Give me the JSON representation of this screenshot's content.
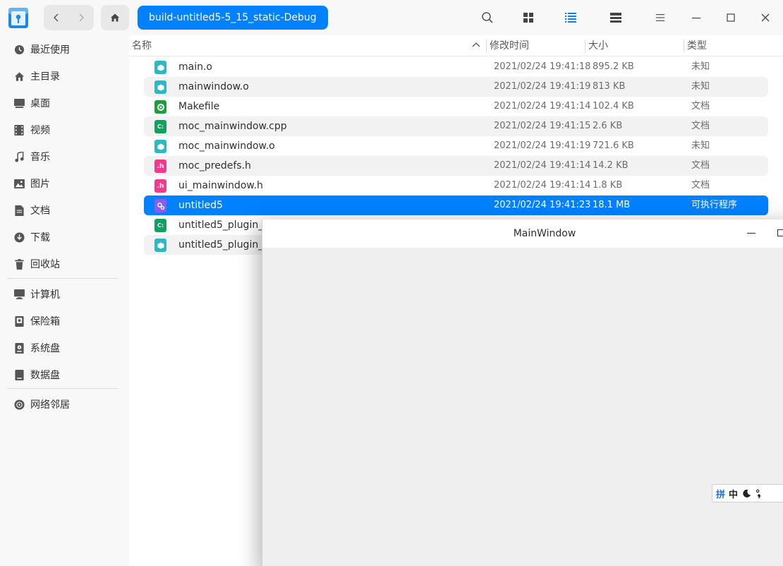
{
  "toolbar": {
    "breadcrumb": "build-untitled5-5_15_static-Debug",
    "icons": [
      "search-icon",
      "icon-view-icon",
      "list-view-icon",
      "detail-view-icon",
      "menu-icon",
      "minimize-icon",
      "maximize-icon",
      "close-icon"
    ]
  },
  "sidebar": {
    "items": [
      {
        "label": "最近使用",
        "icon": "recent-icon"
      },
      {
        "label": "主目录",
        "icon": "home-icon"
      },
      {
        "label": "桌面",
        "icon": "desktop-icon"
      },
      {
        "label": "视频",
        "icon": "video-icon"
      },
      {
        "label": "音乐",
        "icon": "music-icon"
      },
      {
        "label": "图片",
        "icon": "picture-icon"
      },
      {
        "label": "文档",
        "icon": "document-icon"
      },
      {
        "label": "下载",
        "icon": "download-icon"
      },
      {
        "label": "回收站",
        "icon": "trash-icon"
      },
      {
        "label": "计算机",
        "icon": "computer-icon"
      },
      {
        "label": "保险箱",
        "icon": "vault-icon"
      },
      {
        "label": "系统盘",
        "icon": "system-disk-icon"
      },
      {
        "label": "数据盘",
        "icon": "data-disk-icon"
      },
      {
        "label": "网络邻居",
        "icon": "network-icon"
      }
    ]
  },
  "columns": {
    "name": "名称",
    "modified": "修改时间",
    "size": "大小",
    "type": "类型"
  },
  "files": [
    {
      "name": "main.o",
      "modified": "2021/02/24 19:41:18",
      "size": "895.2 KB",
      "type": "未知",
      "icon": "object-file-icon"
    },
    {
      "name": "mainwindow.o",
      "modified": "2021/02/24 19:41:19",
      "size": "813 KB",
      "type": "未知",
      "icon": "object-file-icon"
    },
    {
      "name": "Makefile",
      "modified": "2021/02/24 19:41:14",
      "size": "102.4 KB",
      "type": "文档",
      "icon": "makefile-icon"
    },
    {
      "name": "moc_mainwindow.cpp",
      "modified": "2021/02/24 19:41:15",
      "size": "2.6 KB",
      "type": "文档",
      "icon": "cpp-file-icon"
    },
    {
      "name": "moc_mainwindow.o",
      "modified": "2021/02/24 19:41:19",
      "size": "721.6 KB",
      "type": "未知",
      "icon": "object-file-icon"
    },
    {
      "name": "moc_predefs.h",
      "modified": "2021/02/24 19:41:14",
      "size": "14.2 KB",
      "type": "文档",
      "icon": "header-file-icon"
    },
    {
      "name": "ui_mainwindow.h",
      "modified": "2021/02/24 19:41:14",
      "size": "1.8 KB",
      "type": "文档",
      "icon": "header-file-icon"
    },
    {
      "name": "untitled5",
      "modified": "2021/02/24 19:41:23",
      "size": "18.1 MB",
      "type": "可执行程序",
      "icon": "executable-icon"
    },
    {
      "name": "untitled5_plugin_",
      "modified": "",
      "size": "",
      "type": "",
      "icon": "cpp-file-icon"
    },
    {
      "name": "untitled5_plugin_",
      "modified": "",
      "size": "",
      "type": "",
      "icon": "object-file-icon"
    }
  ],
  "overlay_window": {
    "title": "MainWindow"
  },
  "ime": {
    "mode1": "拼",
    "mode2": "中"
  },
  "colors": {
    "accent": "#0081ff",
    "row_alt": "#f2f2f2"
  }
}
